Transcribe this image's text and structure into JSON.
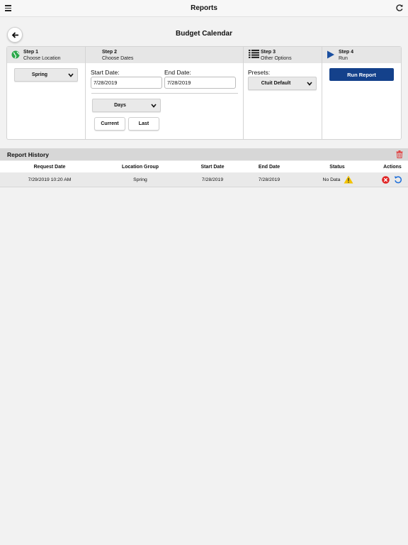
{
  "header": {
    "title": "Reports"
  },
  "page": {
    "title": "Budget Calendar"
  },
  "steps": [
    {
      "number": "Step 1",
      "label": "Choose Location"
    },
    {
      "number": "Step 2",
      "label": "Choose Dates"
    },
    {
      "number": "Step 3",
      "label": "Other Options"
    },
    {
      "number": "Step 4",
      "label": "Run"
    }
  ],
  "location": {
    "selected": "Spring"
  },
  "dates": {
    "start_label": "Start Date:",
    "start_value": "7/28/2019",
    "end_label": "End Date:",
    "end_value": "7/28/2019",
    "period": "Days",
    "current_label": "Current",
    "last_label": "Last"
  },
  "options": {
    "presets_label": "Presets:",
    "preset_selected": "Ctuit Default"
  },
  "run": {
    "button_label": "Run Report"
  },
  "history": {
    "title": "Report History",
    "columns": [
      "Request Date",
      "Location Group",
      "Start Date",
      "End Date",
      "Status",
      "Actions"
    ],
    "rows": [
      {
        "request_date": "7/29/2019 10:20 AM",
        "location_group": "Spring",
        "start_date": "7/28/2019",
        "end_date": "7/28/2019",
        "status": "No Data"
      }
    ]
  },
  "colors": {
    "run_button": "#14418b",
    "warning": "#f2c200",
    "delete": "#e02424",
    "rerun": "#1e6fd9",
    "trash": "#e04040",
    "step1_icon": "#2aa84a",
    "step4_icon": "#1a4fa0"
  }
}
